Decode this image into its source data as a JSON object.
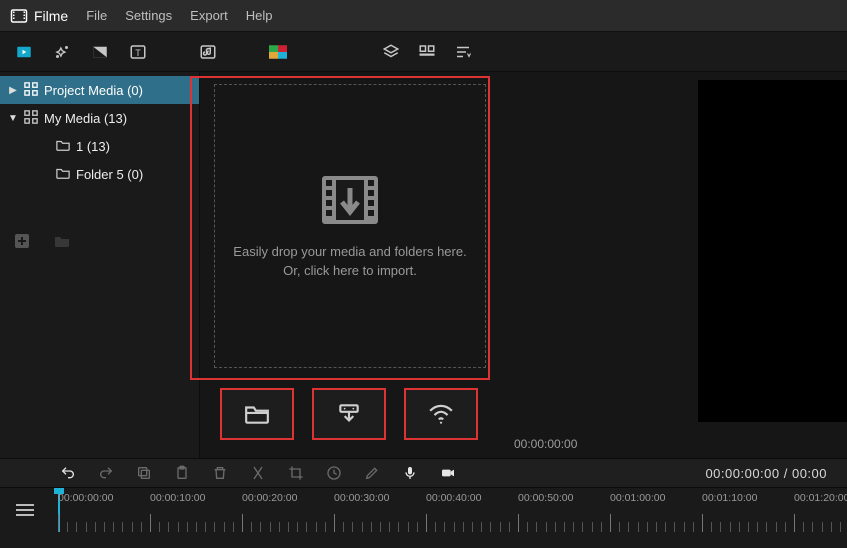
{
  "app": {
    "name": "Filme"
  },
  "menu": {
    "file": "File",
    "settings": "Settings",
    "export": "Export",
    "help": "Help"
  },
  "sidebar": {
    "items": [
      {
        "label": "Project Media (0)"
      },
      {
        "label": "My Media (13)"
      },
      {
        "label": "1 (13)"
      },
      {
        "label": "Folder 5 (0)"
      }
    ]
  },
  "dropzone": {
    "line1": "Easily drop your media and folders here.",
    "line2": "Or, click here to import."
  },
  "preview": {
    "time": "00:00:00:00"
  },
  "timeline": {
    "readout": "00:00:00:00 / 00:00"
  },
  "ruler": {
    "labels": [
      "00:00:00:00",
      "00:00:10:00",
      "00:00:20:00",
      "00:00:30:00",
      "00:00:40:00",
      "00:00:50:00",
      "00:01:00:00",
      "00:01:10:00",
      "00:01:20:00"
    ]
  }
}
